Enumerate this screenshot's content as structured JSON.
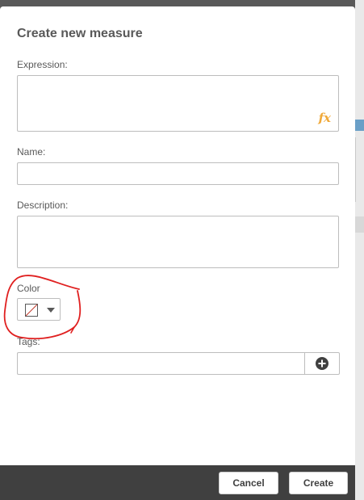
{
  "dialog": {
    "title": "Create new measure",
    "expression": {
      "label": "Expression:",
      "value": "",
      "fx_glyph": "fx"
    },
    "name": {
      "label": "Name:",
      "value": ""
    },
    "description": {
      "label": "Description:",
      "value": ""
    },
    "color": {
      "label": "Color",
      "selected": "none",
      "dropdown_icon": "caret-down-icon"
    },
    "tags": {
      "label": "Tags:",
      "value": "",
      "add_icon": "plus-circle-icon"
    },
    "footer": {
      "cancel_label": "Cancel",
      "create_label": "Create"
    }
  },
  "annotation": {
    "color": "#e02020",
    "shape": "freehand circle around Color picker"
  },
  "colors": {
    "dialog_bg": "#ffffff",
    "footer_bg": "#404040",
    "fx_color": "#f0a93a",
    "text": "#595959"
  }
}
